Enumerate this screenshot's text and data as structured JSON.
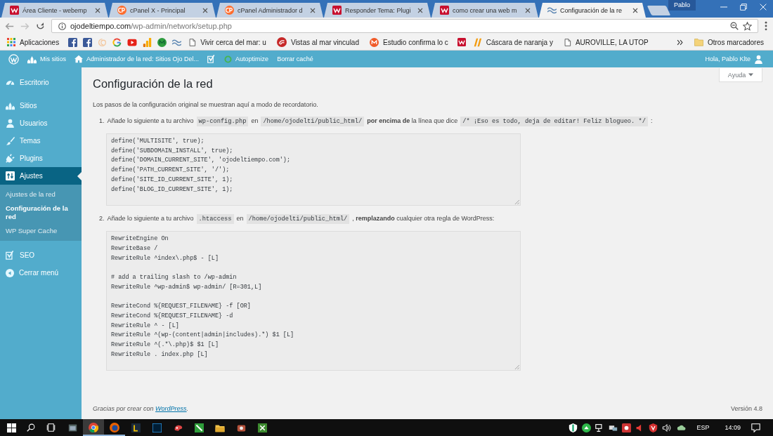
{
  "browser": {
    "tabs": [
      {
        "title": "Área Cliente - webemp",
        "selected": false
      },
      {
        "title": "cPanel X - Principal",
        "selected": false
      },
      {
        "title": "cPanel Administrador d",
        "selected": false
      },
      {
        "title": "Responder Tema: Plugi",
        "selected": false
      },
      {
        "title": "como crear una web m",
        "selected": false
      },
      {
        "title": "Configuración de la re",
        "selected": true
      }
    ],
    "profile": "Pablo",
    "address": {
      "host": "ojodeltiempo.com",
      "path": "/wp-admin/network/setup.php"
    },
    "bookmarks": [
      {
        "kind": "link",
        "label": "Aplicaciones"
      },
      {
        "kind": "icon"
      },
      {
        "kind": "icon"
      },
      {
        "kind": "icon"
      },
      {
        "kind": "icon"
      },
      {
        "kind": "icon"
      },
      {
        "kind": "icon"
      },
      {
        "kind": "icon"
      },
      {
        "kind": "icon"
      },
      {
        "kind": "link",
        "label": "Vivir cerca del mar: u"
      },
      {
        "kind": "link",
        "label": "Vistas al mar vinculad"
      },
      {
        "kind": "link",
        "label": "Estudio confirma lo c"
      },
      {
        "kind": "icon"
      },
      {
        "kind": "link",
        "label": "Cáscara de naranja y"
      },
      {
        "kind": "link",
        "label": "AUROVILLE, LA UTOP"
      }
    ],
    "other_bookmarks": "Otros marcadores"
  },
  "admin_bar": {
    "items": [
      {
        "kind": "icon"
      },
      {
        "kind": "link",
        "label": "Mis sitios"
      },
      {
        "kind": "link",
        "label": "Administrador de la red: Sitios Ojo Del..."
      },
      {
        "kind": "icon"
      },
      {
        "kind": "link",
        "label": "Autoptimize"
      },
      {
        "kind": "link",
        "label": "Borrar caché"
      }
    ],
    "account": "Hola, Pablo Klte"
  },
  "sidebar": {
    "items": [
      {
        "label": "Escritorio",
        "selected": false
      },
      {
        "label": "Sitios",
        "selected": false
      },
      {
        "label": "Usuarios",
        "selected": false
      },
      {
        "label": "Temas",
        "selected": false
      },
      {
        "label": "Plugins",
        "selected": false
      },
      {
        "label": "Ajustes",
        "selected": true,
        "children": [
          {
            "label": "Ajustes de la red",
            "selected": false
          },
          {
            "label": "Configuración de la red",
            "selected": true
          },
          {
            "label": "WP Super Cache",
            "selected": false
          }
        ]
      },
      {
        "label": "SEO",
        "selected": false
      },
      {
        "label": "Cerrar menú",
        "selected": false
      }
    ]
  },
  "help_button": "Ayuda",
  "page": {
    "title": "Configuración de la red",
    "intro": "Los pasos de la configuración original se muestran aquí a modo de recordatorio.",
    "steps": [
      {
        "number": "1.",
        "segments": [
          {
            "kind": "text",
            "text": "Añade lo siguiente a tu archivo"
          },
          {
            "kind": "code",
            "text": "wp-config.php"
          },
          {
            "kind": "text",
            "text": "en"
          },
          {
            "kind": "code",
            "text": "/home/ojodelti/public_html/"
          },
          {
            "kind": "text",
            "text": "**por encima de** la línea que dice"
          },
          {
            "kind": "code",
            "text": "/* ¡Eso es todo, deja de editar! Feliz blogueo. */"
          },
          {
            "kind": "text",
            "text": ":"
          }
        ],
        "code": "define('MULTISITE', true);\ndefine('SUBDOMAIN_INSTALL', true);\ndefine('DOMAIN_CURRENT_SITE', 'ojodeltiempo.com');\ndefine('PATH_CURRENT_SITE', '/');\ndefine('SITE_ID_CURRENT_SITE', 1);\ndefine('BLOG_ID_CURRENT_SITE', 1);"
      },
      {
        "number": "2.",
        "segments": [
          {
            "kind": "text",
            "text": "Añade lo siguiente a tu archivo"
          },
          {
            "kind": "code",
            "text": ".htaccess"
          },
          {
            "kind": "text",
            "text": "en"
          },
          {
            "kind": "code",
            "text": "/home/ojodelti/public_html/"
          },
          {
            "kind": "text",
            "text": ", **remplazando** cualquier otra regla de WordPress:"
          }
        ],
        "code": "RewriteEngine On\nRewriteBase /\nRewriteRule ^index\\.php$ - [L]\n\n# add a trailing slash to /wp-admin\nRewriteRule ^wp-admin$ wp-admin/ [R=301,L]\n\nRewriteCond %{REQUEST_FILENAME} -f [OR]\nRewriteCond %{REQUEST_FILENAME} -d\nRewriteRule ^ - [L]\nRewriteRule ^(wp-(content|admin|includes).*) $1 [L]\nRewriteRule ^(.*\\.php)$ $1 [L]\nRewriteRule . index.php [L]"
      }
    ]
  },
  "footer": {
    "credit_before": "Gracias por crear con",
    "credit_link": "WordPress",
    "credit_after": ".",
    "version": "Versión 4.8"
  },
  "taskbar": {
    "apps": [
      {
        "running": false,
        "selected": false
      },
      {
        "running": true,
        "selected": true
      },
      {
        "running": true,
        "selected": false
      },
      {
        "running": false,
        "selected": false
      },
      {
        "running": false,
        "selected": false
      },
      {
        "running": false,
        "selected": false
      },
      {
        "running": false,
        "selected": false
      },
      {
        "running": false,
        "selected": false
      },
      {
        "running": false,
        "selected": false
      },
      {
        "running": false,
        "selected": false
      }
    ],
    "language": "ESP",
    "time": "14:09"
  }
}
